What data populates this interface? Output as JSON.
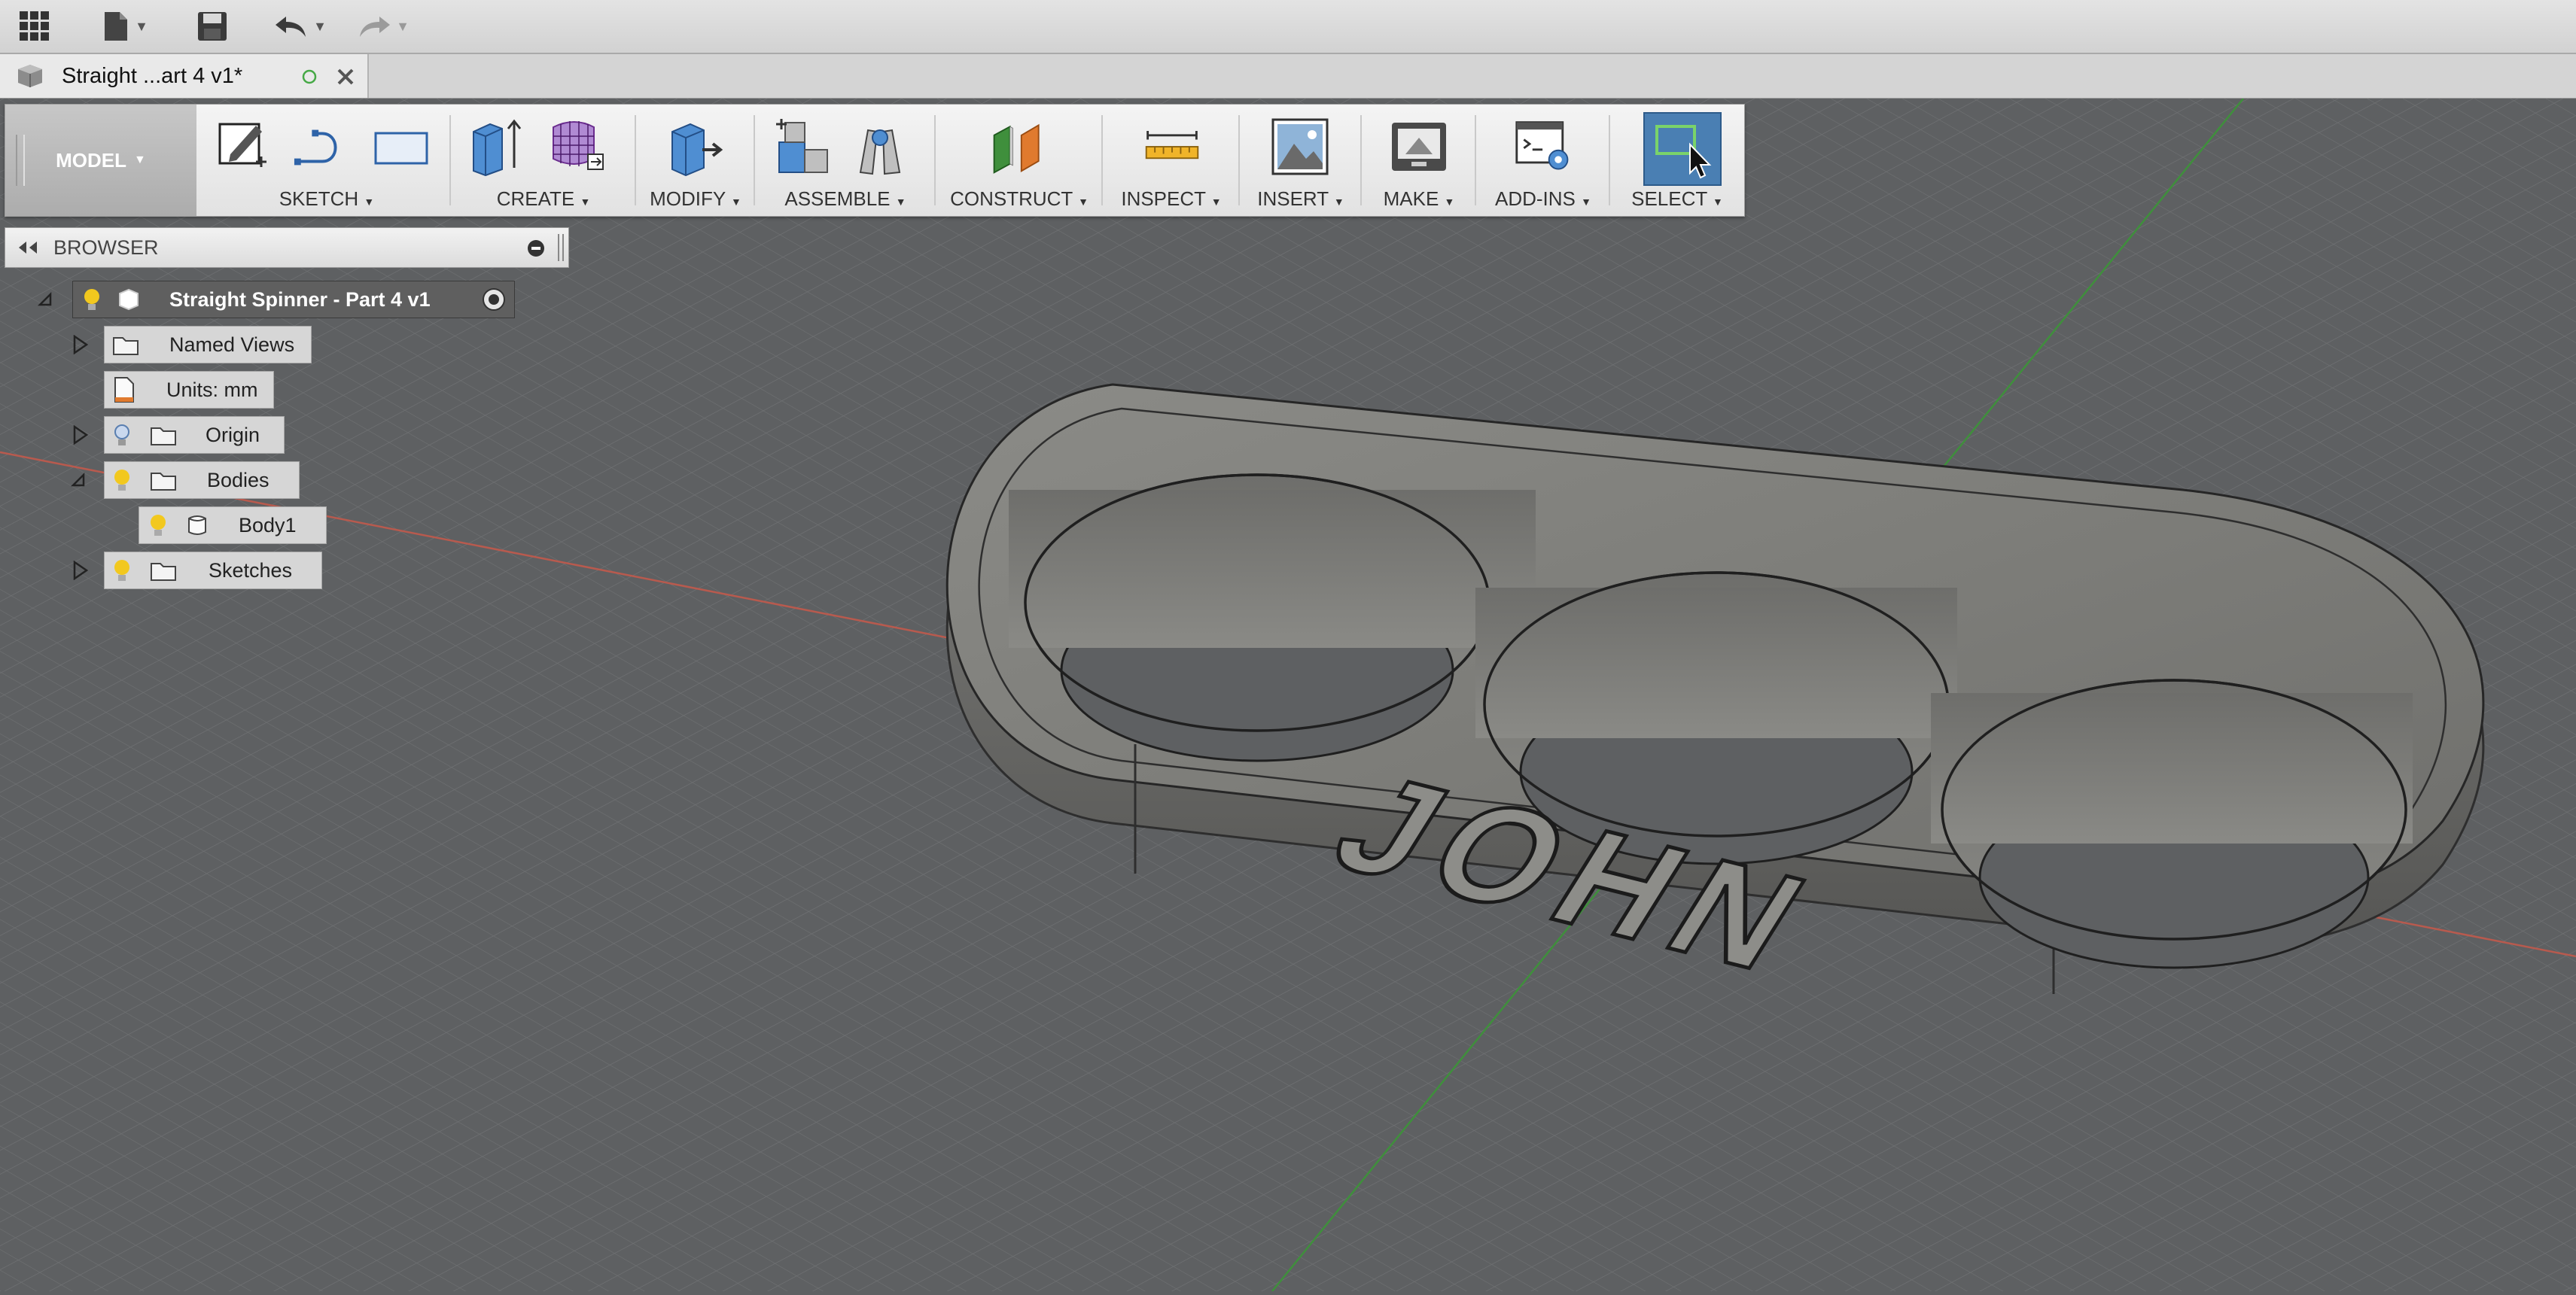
{
  "appbar": {
    "icons": [
      "apps-grid-icon",
      "file-icon",
      "save-icon",
      "undo-icon",
      "redo-icon"
    ]
  },
  "tab": {
    "title": "Straight ...art 4 v1*",
    "icons": [
      "part-icon",
      "sync-circle-icon",
      "close-icon"
    ]
  },
  "ribbon": {
    "workspace": "MODEL",
    "groups": [
      "SKETCH",
      "CREATE",
      "MODIFY",
      "ASSEMBLE",
      "CONSTRUCT",
      "INSPECT",
      "INSERT",
      "MAKE",
      "ADD-INS",
      "SELECT"
    ]
  },
  "browser": {
    "title": "BROWSER",
    "root": "Straight Spinner - Part 4 v1",
    "items": [
      {
        "label": "Named Views"
      },
      {
        "label": "Units: mm"
      },
      {
        "label": "Origin"
      },
      {
        "label": "Bodies"
      },
      {
        "label": "Body1"
      },
      {
        "label": "Sketches"
      }
    ]
  },
  "model": {
    "engraved_text": "JOHN"
  },
  "colors": {
    "viewport_bg": "#5e6062",
    "grid": "#6d6f71",
    "model_body": "#7a7a77",
    "select_active": "#4a7fb3",
    "axis_x": "#b85a4e",
    "axis_y": "#3f8f3c"
  }
}
